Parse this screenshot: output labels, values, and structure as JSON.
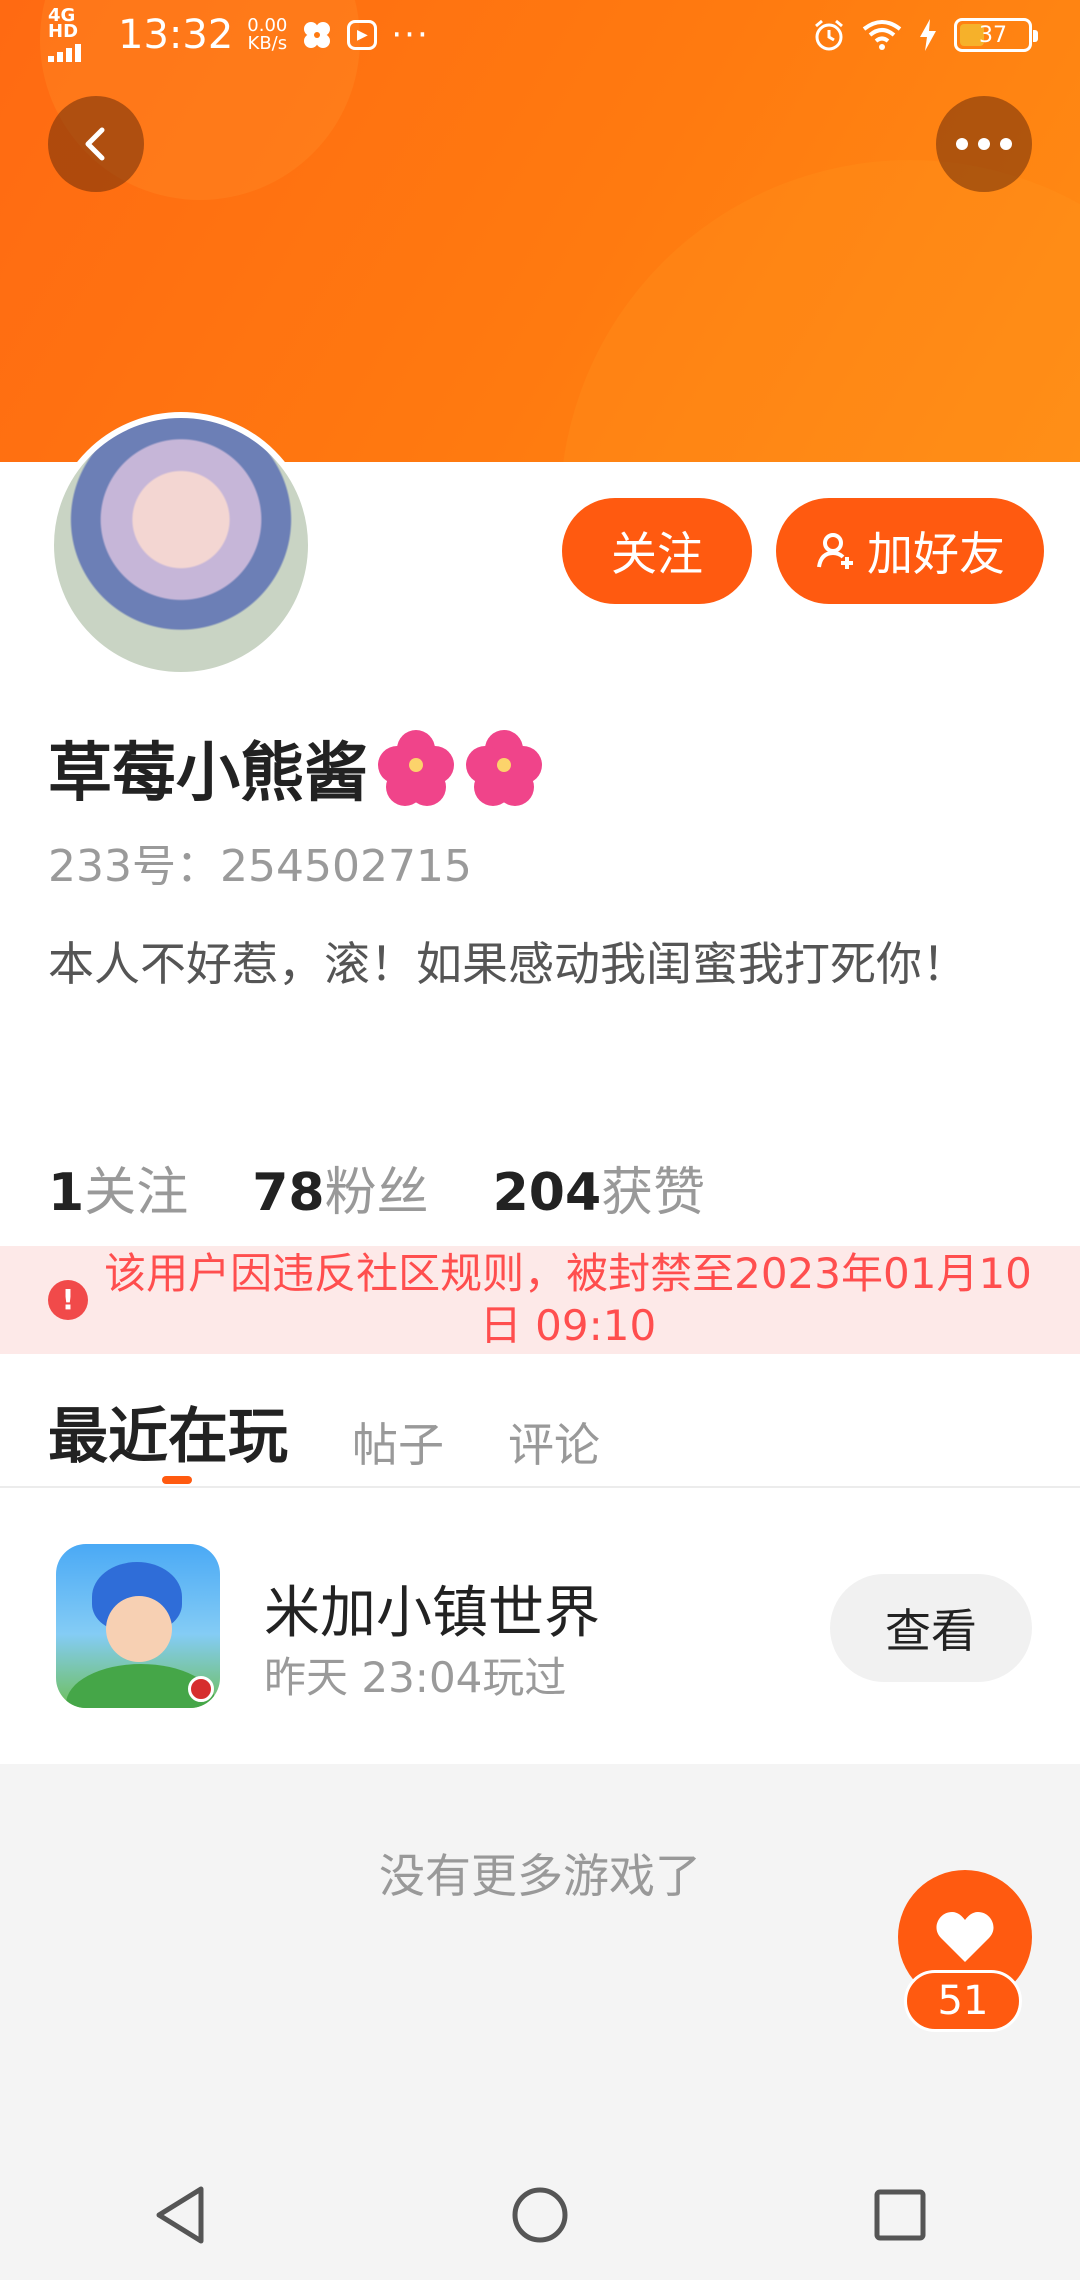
{
  "status_bar": {
    "network": "4G HD",
    "time": "13:32",
    "net_speed_value": "0.00",
    "net_speed_unit": "KB/s",
    "more": "···",
    "battery": "37"
  },
  "header": {
    "back_icon": "chevron-left-icon",
    "more_icon": "more-horizontal-icon"
  },
  "profile": {
    "follow_label": "关注",
    "add_friend_label": "加好友",
    "username": "草莓小熊酱",
    "uid": "233号：254502715",
    "bio": "本人不好惹，滚！如果感动我闺蜜我打死你！",
    "stats": [
      {
        "number": "1",
        "label": "关注"
      },
      {
        "number": "78",
        "label": "粉丝"
      },
      {
        "number": "204",
        "label": "获赞"
      }
    ]
  },
  "ban_notice": "该用户因违反社区规则，被封禁至2023年01月10日 09:10",
  "tabs": [
    {
      "label": "最近在玩",
      "active": true
    },
    {
      "label": "帖子",
      "active": false
    },
    {
      "label": "评论",
      "active": false
    }
  ],
  "recent_game": {
    "title": "米加小镇世界",
    "subtitle": "昨天 23:04玩过",
    "view_label": "查看"
  },
  "empty_text": "没有更多游戏了",
  "like_count": "51",
  "colors": {
    "accent": "#ff5a10",
    "ban_bg": "#fde9e8",
    "ban_text": "#ff4e4e"
  }
}
